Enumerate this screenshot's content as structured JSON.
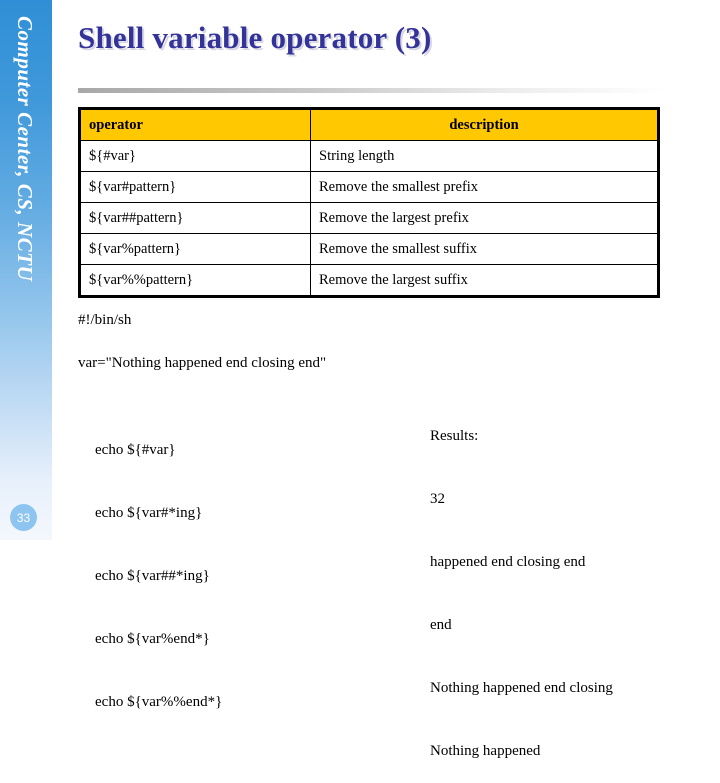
{
  "sidebar": {
    "brand": "Computer Center, CS, NCTU",
    "page_number": "33"
  },
  "title": "Shell variable operator (3)",
  "table": {
    "headers": [
      "operator",
      "description"
    ],
    "rows": [
      [
        "${#var}",
        "String length"
      ],
      [
        "${var#pattern}",
        "Remove the smallest prefix"
      ],
      [
        "${var##pattern}",
        "Remove the largest prefix"
      ],
      [
        "${var%pattern}",
        "Remove the smallest suffix"
      ],
      [
        "${var%%pattern}",
        "Remove the largest suffix"
      ]
    ]
  },
  "script": {
    "shebang": "#!/bin/sh",
    "var_assign": "var=\"Nothing happened end closing end\"",
    "echo_lines": [
      "echo ${#var}",
      "echo ${var#*ing}",
      "echo ${var##*ing}",
      "echo ${var%end*}",
      "echo ${var%%end*}"
    ]
  },
  "results": {
    "label": "Results:",
    "lines": [
      "32",
      "happened end closing end",
      "end",
      "Nothing happened end closing",
      "Nothing happened"
    ]
  },
  "colors": {
    "title": "#333399",
    "table_header_bg": "#ffc800",
    "sidebar_top": "#2f8fd6",
    "page_badge": "#8ec5f0"
  }
}
